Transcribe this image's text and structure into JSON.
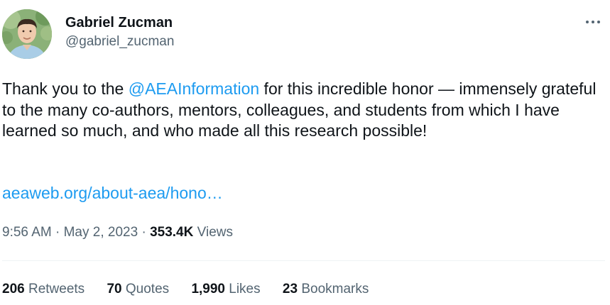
{
  "author": {
    "display_name": "Gabriel Zucman",
    "handle": "@gabriel_zucman"
  },
  "tweet": {
    "text_before_mention": "Thank you to the ",
    "mention": "@AEAInformation",
    "text_after_mention": " for this incredible honor — immensely grateful to the many co-authors, mentors, colleagues, and students from which I have learned so much, and who made all this research possible!",
    "link": "aeaweb.org/about-aea/hono…"
  },
  "meta": {
    "time": "9:56 AM",
    "separator": " · ",
    "date": "May 2, 2023",
    "views_count": "353.4K",
    "views_label": " Views"
  },
  "stats": {
    "retweets": {
      "count": "206",
      "label": " Retweets"
    },
    "quotes": {
      "count": "70",
      "label": " Quotes"
    },
    "likes": {
      "count": "1,990",
      "label": " Likes"
    },
    "bookmarks": {
      "count": "23",
      "label": " Bookmarks"
    }
  },
  "icons": {
    "more": "more-horizontal-icon"
  },
  "colors": {
    "text": "#0f1419",
    "secondary": "#536471",
    "link": "#1d9bf0",
    "divider": "#eff3f4"
  }
}
